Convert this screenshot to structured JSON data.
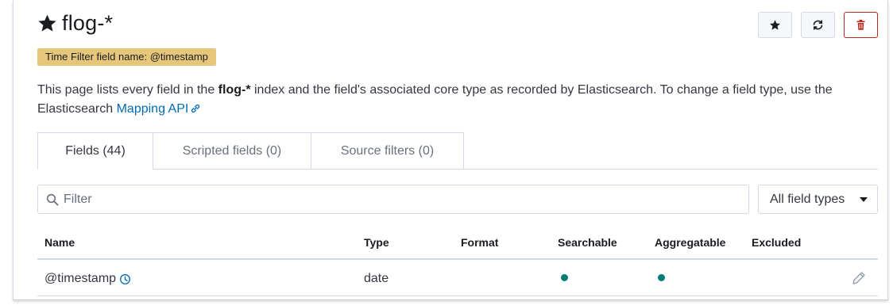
{
  "header": {
    "title": "flog-*",
    "time_filter_badge": "Time Filter field name: @timestamp",
    "buttons": {
      "favorite": "star-icon",
      "refresh": "refresh-icon",
      "delete": "trash-icon"
    }
  },
  "description": {
    "part1": "This page lists every field in the ",
    "index_name": "flog-*",
    "part2": " index and the field's associated core type as recorded by Elasticsearch. To change a field type, use the Elasticsearch ",
    "link_text": "Mapping API"
  },
  "tabs": [
    {
      "label": "Fields (44)",
      "active": true
    },
    {
      "label": "Scripted fields (0)",
      "active": false
    },
    {
      "label": "Source filters (0)",
      "active": false
    }
  ],
  "filter": {
    "placeholder": "Filter",
    "value": ""
  },
  "field_type_select": {
    "selected": "All field types"
  },
  "table": {
    "columns": [
      "Name",
      "Type",
      "Format",
      "Searchable",
      "Aggregatable",
      "Excluded"
    ],
    "rows": [
      {
        "name": "@timestamp",
        "is_time_field": true,
        "type": "date",
        "format": "",
        "searchable": true,
        "aggregatable": true,
        "excluded": false
      }
    ]
  },
  "colors": {
    "accent": "#006bb4",
    "badge": "#e6c67a",
    "danger": "#bd271e",
    "success_dot": "#017d73"
  }
}
